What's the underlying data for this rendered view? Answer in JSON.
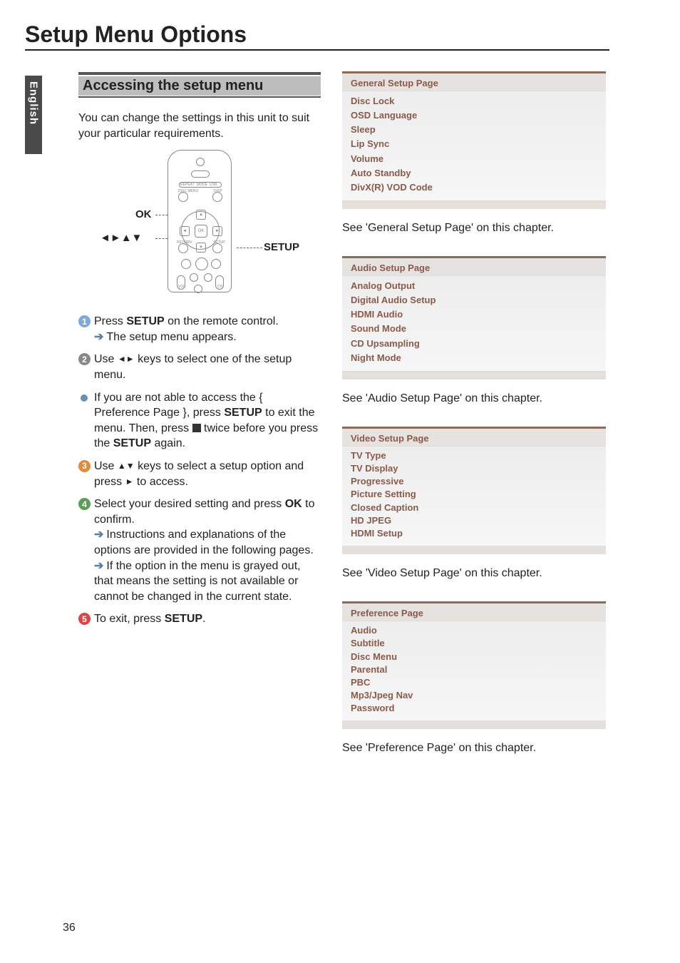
{
  "page_number": "36",
  "lang_tab": "English",
  "title": "Setup Menu Options",
  "subhead": "Accessing the setup menu",
  "intro": "You can change the settings in this unit to suit your particular requirements.",
  "remote": {
    "ok_label": "OK",
    "arrows_label": "◄►▲▼",
    "setup_label": "SETUP"
  },
  "steps": {
    "s1a": "Press ",
    "s1b": "SETUP",
    "s1c": " on the remote control.",
    "s1_sub_a": "The setup menu appears.",
    "s2a": "Use ",
    "s2b": " keys to select one of the setup menu.",
    "bullet_a": "If you are not able to access the { Preference Page }, press ",
    "bullet_b": "SETUP",
    "bullet_c": " to exit the menu. Then, press ",
    "bullet_d": " twice before you press the ",
    "bullet_e": "SETUP",
    "bullet_f": " again.",
    "s3a": "Use ",
    "s3b": " keys to select a setup option and press ",
    "s3c": " to access.",
    "s4a": "Select your desired setting and press ",
    "s4b": "OK",
    "s4c": " to confirm.",
    "s4_sub_a": "Instructions and explanations of the options are provided in the following pages.",
    "s4_sub_b": "If the option in the menu is grayed out, that means the setting is not available or cannot be changed in the current state.",
    "s5a": "To exit, press ",
    "s5b": "SETUP",
    "s5c": "."
  },
  "panels": {
    "general": {
      "title": "General Setup Page",
      "items": [
        "Disc Lock",
        "OSD Language",
        "Sleep",
        "Lip Sync",
        "Volume",
        "Auto Standby",
        "DivX(R) VOD Code"
      ],
      "caption": "See 'General Setup Page' on this chapter."
    },
    "audio": {
      "title": "Audio Setup Page",
      "items": [
        "Analog Output",
        "Digital Audio Setup",
        "HDMI Audio",
        "Sound Mode",
        "CD Upsampling",
        "Night Mode"
      ],
      "caption": "See 'Audio Setup Page' on this chapter."
    },
    "video": {
      "title": "Video Setup Page",
      "items": [
        "TV Type",
        "TV Display",
        "Progressive",
        "Picture Setting",
        "Closed Caption",
        "HD JPEG",
        "HDMI Setup"
      ],
      "caption": "See 'Video Setup Page' on this chapter."
    },
    "pref": {
      "title": "Preference Page",
      "items": [
        "Audio",
        "Subtitle",
        "Disc Menu",
        "Parental",
        "PBC",
        "Mp3/Jpeg Nav",
        "Password"
      ],
      "caption": "See 'Preference Page' on this chapter."
    }
  }
}
